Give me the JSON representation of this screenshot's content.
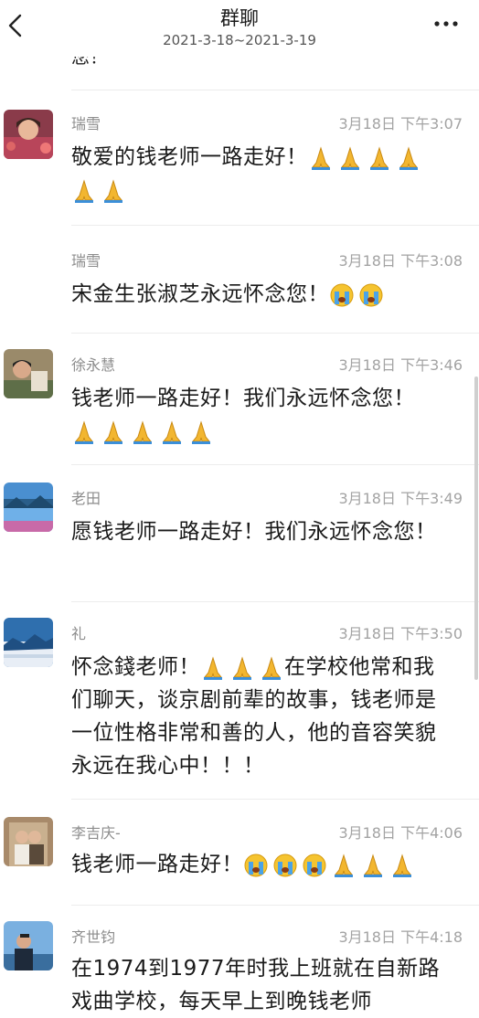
{
  "header": {
    "title": "群聊",
    "date_range": "2021-3-18~2021-3-19"
  },
  "previous_snippet": "您！",
  "messages": [
    {
      "sender": "瑞雪",
      "time": "3月18日 下午3:07",
      "text": "敬爱的钱老师一路走好！",
      "emojis_after": [
        "praying-hands",
        "praying-hands",
        "praying-hands",
        "praying-hands",
        "praying-hands",
        "praying-hands"
      ]
    },
    {
      "sender": "瑞雪",
      "time": "3月18日 下午3:08",
      "text": "宋金生张淑芝永远怀念您！",
      "emojis_after": [
        "crying-face",
        "crying-face"
      ]
    },
    {
      "sender": "徐永慧",
      "time": "3月18日 下午3:46",
      "text": "钱老师一路走好！我们永远怀念您！",
      "emojis_after": [
        "praying-hands",
        "praying-hands",
        "praying-hands",
        "praying-hands",
        "praying-hands"
      ]
    },
    {
      "sender": "老田",
      "time": "3月18日 下午3:49",
      "text": "愿钱老师一路走好！我们永远怀念您！"
    },
    {
      "sender": "礼",
      "time": "3月18日 下午3:50",
      "text_before": "怀念錢老师！",
      "text_after": "在学校他常和我们聊天，谈京剧前辈的故事，钱老师是一位性格非常和善的人，他的音容笑貌永远在我心中！！！",
      "emojis_mid": [
        "praying-hands",
        "praying-hands",
        "praying-hands"
      ]
    },
    {
      "sender": "李吉庆-",
      "time": "3月18日 下午4:06",
      "text": "钱老师一路走好！",
      "emojis_after": [
        "crying-face",
        "crying-face",
        "crying-face",
        "praying-hands",
        "praying-hands",
        "praying-hands"
      ]
    },
    {
      "sender": "齐世钧",
      "time": "3月18日 下午4:18",
      "text": "在1974到1977年时我上班就在自新路戏曲学校，每天早上到晚钱老师"
    }
  ]
}
